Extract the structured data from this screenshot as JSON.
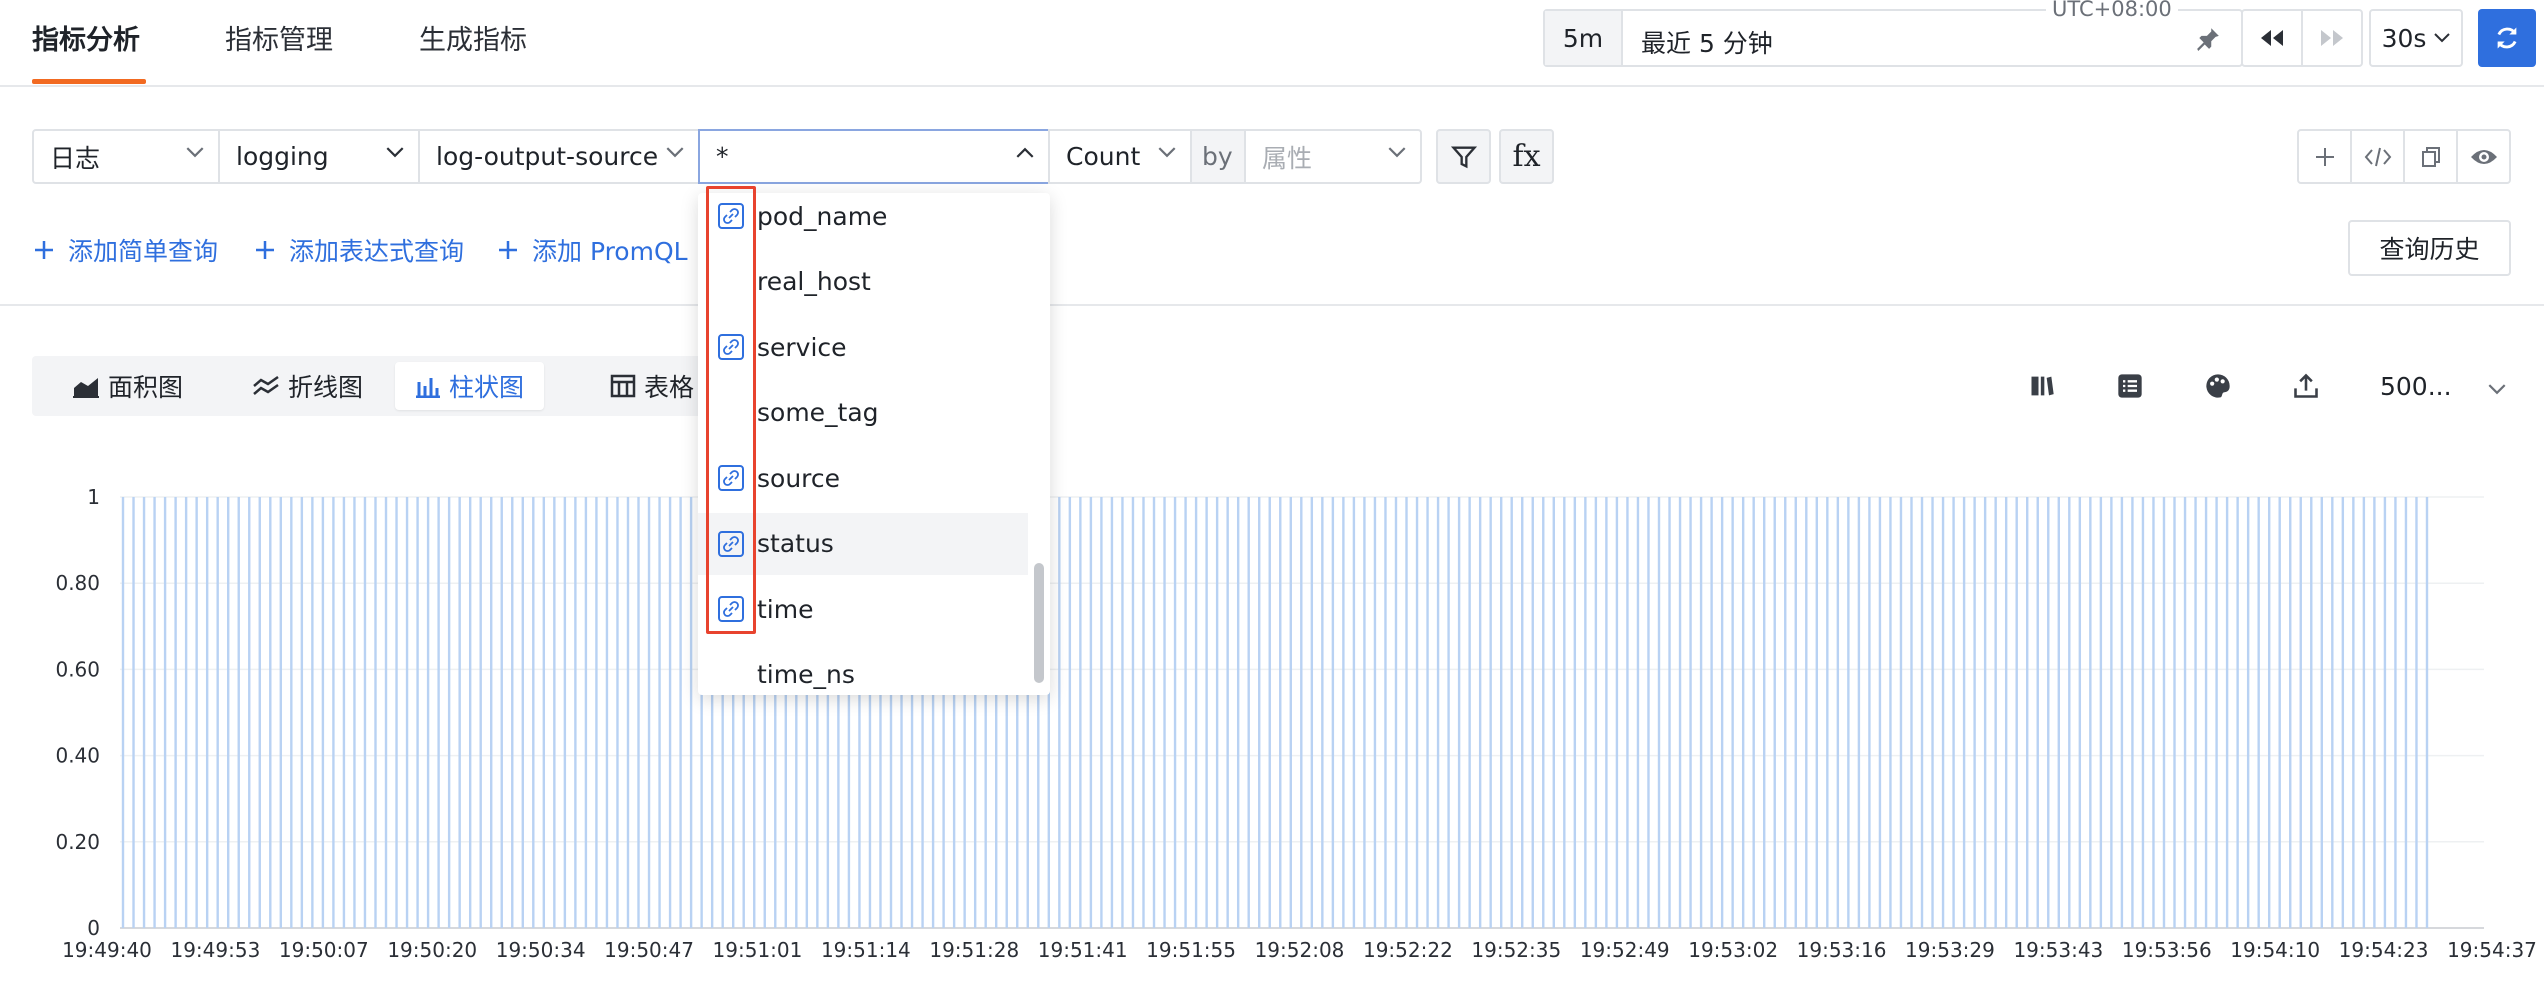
{
  "top_tabs": {
    "analysis": "指标分析",
    "management": "指标管理",
    "generate": "生成指标"
  },
  "time": {
    "short": "5m",
    "range_text": "最近 5 分钟",
    "timezone": "UTC+08:00",
    "interval": "30s"
  },
  "query": {
    "source_type": "日志",
    "index": "logging",
    "source": "log-output-source",
    "field": "*",
    "aggregation": "Count",
    "by_label": "by",
    "by_placeholder": "属性",
    "fx": "fx"
  },
  "add_links": {
    "simple": "添加简单查询",
    "expression": "添加表达式查询",
    "promql": "添加 PromQL"
  },
  "history_button": "查询历史",
  "chart_tabs": {
    "area": "面积图",
    "line": "折线图",
    "bar": "柱状图",
    "table": "表格"
  },
  "limit_select": "500...",
  "dropdown_items": [
    {
      "label": "pod_name",
      "linked": true
    },
    {
      "label": "real_host",
      "linked": false
    },
    {
      "label": "service",
      "linked": true
    },
    {
      "label": "some_tag",
      "linked": false
    },
    {
      "label": "source",
      "linked": true
    },
    {
      "label": "status",
      "linked": true
    },
    {
      "label": "time",
      "linked": true
    },
    {
      "label": "time_ns",
      "linked": false
    }
  ],
  "colors": {
    "accent": "#2f6fde",
    "tab_underline": "#f26a21",
    "highlight_box": "#e8432e",
    "bar": "#b9d2f3"
  },
  "chart_data": {
    "type": "bar",
    "y_ticks": [
      "1",
      "0.80",
      "0.60",
      "0.40",
      "0.20",
      "0"
    ],
    "ylim": [
      0,
      1
    ],
    "x_ticks": [
      "19:49:40",
      "19:49:53",
      "19:50:07",
      "19:50:20",
      "19:50:34",
      "19:50:47",
      "19:51:01",
      "19:51:14",
      "19:51:28",
      "19:51:41",
      "19:51:55",
      "19:52:08",
      "19:52:22",
      "19:52:35",
      "19:52:49",
      "19:53:02",
      "19:53:16",
      "19:53:29",
      "19:53:43",
      "19:53:56",
      "19:54:10",
      "19:54:23",
      "19:54:37"
    ],
    "series": [
      {
        "values_constant": 1,
        "bar_count": 220
      }
    ],
    "grid": true
  }
}
